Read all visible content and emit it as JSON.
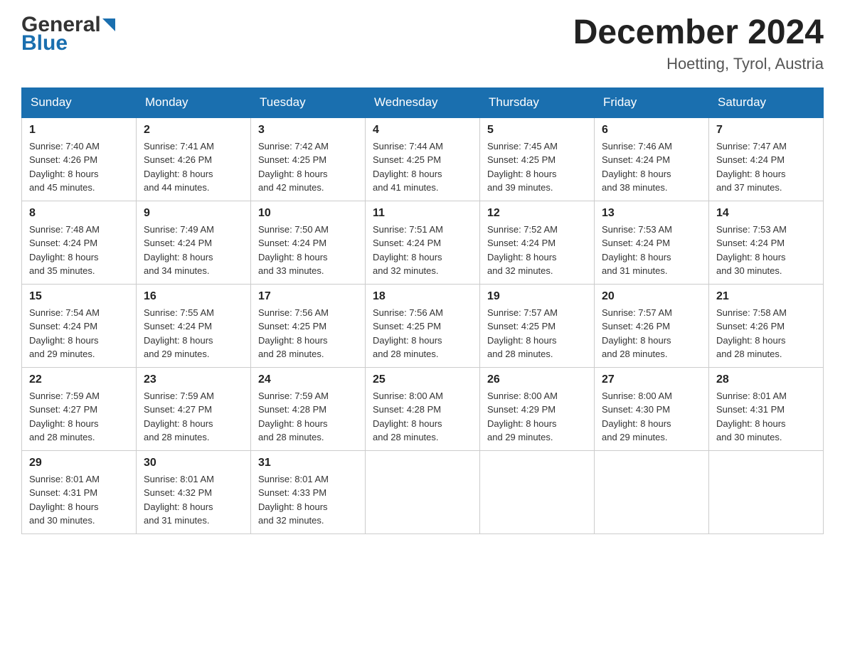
{
  "header": {
    "logo_general": "General",
    "logo_blue": "Blue",
    "month_title": "December 2024",
    "location": "Hoetting, Tyrol, Austria"
  },
  "days_of_week": [
    "Sunday",
    "Monday",
    "Tuesday",
    "Wednesday",
    "Thursday",
    "Friday",
    "Saturday"
  ],
  "weeks": [
    [
      {
        "day": "1",
        "sunrise": "7:40 AM",
        "sunset": "4:26 PM",
        "daylight": "8 hours and 45 minutes."
      },
      {
        "day": "2",
        "sunrise": "7:41 AM",
        "sunset": "4:26 PM",
        "daylight": "8 hours and 44 minutes."
      },
      {
        "day": "3",
        "sunrise": "7:42 AM",
        "sunset": "4:25 PM",
        "daylight": "8 hours and 42 minutes."
      },
      {
        "day": "4",
        "sunrise": "7:44 AM",
        "sunset": "4:25 PM",
        "daylight": "8 hours and 41 minutes."
      },
      {
        "day": "5",
        "sunrise": "7:45 AM",
        "sunset": "4:25 PM",
        "daylight": "8 hours and 39 minutes."
      },
      {
        "day": "6",
        "sunrise": "7:46 AM",
        "sunset": "4:24 PM",
        "daylight": "8 hours and 38 minutes."
      },
      {
        "day": "7",
        "sunrise": "7:47 AM",
        "sunset": "4:24 PM",
        "daylight": "8 hours and 37 minutes."
      }
    ],
    [
      {
        "day": "8",
        "sunrise": "7:48 AM",
        "sunset": "4:24 PM",
        "daylight": "8 hours and 35 minutes."
      },
      {
        "day": "9",
        "sunrise": "7:49 AM",
        "sunset": "4:24 PM",
        "daylight": "8 hours and 34 minutes."
      },
      {
        "day": "10",
        "sunrise": "7:50 AM",
        "sunset": "4:24 PM",
        "daylight": "8 hours and 33 minutes."
      },
      {
        "day": "11",
        "sunrise": "7:51 AM",
        "sunset": "4:24 PM",
        "daylight": "8 hours and 32 minutes."
      },
      {
        "day": "12",
        "sunrise": "7:52 AM",
        "sunset": "4:24 PM",
        "daylight": "8 hours and 32 minutes."
      },
      {
        "day": "13",
        "sunrise": "7:53 AM",
        "sunset": "4:24 PM",
        "daylight": "8 hours and 31 minutes."
      },
      {
        "day": "14",
        "sunrise": "7:53 AM",
        "sunset": "4:24 PM",
        "daylight": "8 hours and 30 minutes."
      }
    ],
    [
      {
        "day": "15",
        "sunrise": "7:54 AM",
        "sunset": "4:24 PM",
        "daylight": "8 hours and 29 minutes."
      },
      {
        "day": "16",
        "sunrise": "7:55 AM",
        "sunset": "4:24 PM",
        "daylight": "8 hours and 29 minutes."
      },
      {
        "day": "17",
        "sunrise": "7:56 AM",
        "sunset": "4:25 PM",
        "daylight": "8 hours and 28 minutes."
      },
      {
        "day": "18",
        "sunrise": "7:56 AM",
        "sunset": "4:25 PM",
        "daylight": "8 hours and 28 minutes."
      },
      {
        "day": "19",
        "sunrise": "7:57 AM",
        "sunset": "4:25 PM",
        "daylight": "8 hours and 28 minutes."
      },
      {
        "day": "20",
        "sunrise": "7:57 AM",
        "sunset": "4:26 PM",
        "daylight": "8 hours and 28 minutes."
      },
      {
        "day": "21",
        "sunrise": "7:58 AM",
        "sunset": "4:26 PM",
        "daylight": "8 hours and 28 minutes."
      }
    ],
    [
      {
        "day": "22",
        "sunrise": "7:59 AM",
        "sunset": "4:27 PM",
        "daylight": "8 hours and 28 minutes."
      },
      {
        "day": "23",
        "sunrise": "7:59 AM",
        "sunset": "4:27 PM",
        "daylight": "8 hours and 28 minutes."
      },
      {
        "day": "24",
        "sunrise": "7:59 AM",
        "sunset": "4:28 PM",
        "daylight": "8 hours and 28 minutes."
      },
      {
        "day": "25",
        "sunrise": "8:00 AM",
        "sunset": "4:28 PM",
        "daylight": "8 hours and 28 minutes."
      },
      {
        "day": "26",
        "sunrise": "8:00 AM",
        "sunset": "4:29 PM",
        "daylight": "8 hours and 29 minutes."
      },
      {
        "day": "27",
        "sunrise": "8:00 AM",
        "sunset": "4:30 PM",
        "daylight": "8 hours and 29 minutes."
      },
      {
        "day": "28",
        "sunrise": "8:01 AM",
        "sunset": "4:31 PM",
        "daylight": "8 hours and 30 minutes."
      }
    ],
    [
      {
        "day": "29",
        "sunrise": "8:01 AM",
        "sunset": "4:31 PM",
        "daylight": "8 hours and 30 minutes."
      },
      {
        "day": "30",
        "sunrise": "8:01 AM",
        "sunset": "4:32 PM",
        "daylight": "8 hours and 31 minutes."
      },
      {
        "day": "31",
        "sunrise": "8:01 AM",
        "sunset": "4:33 PM",
        "daylight": "8 hours and 32 minutes."
      },
      null,
      null,
      null,
      null
    ]
  ],
  "labels": {
    "sunrise": "Sunrise:",
    "sunset": "Sunset:",
    "daylight": "Daylight:"
  }
}
